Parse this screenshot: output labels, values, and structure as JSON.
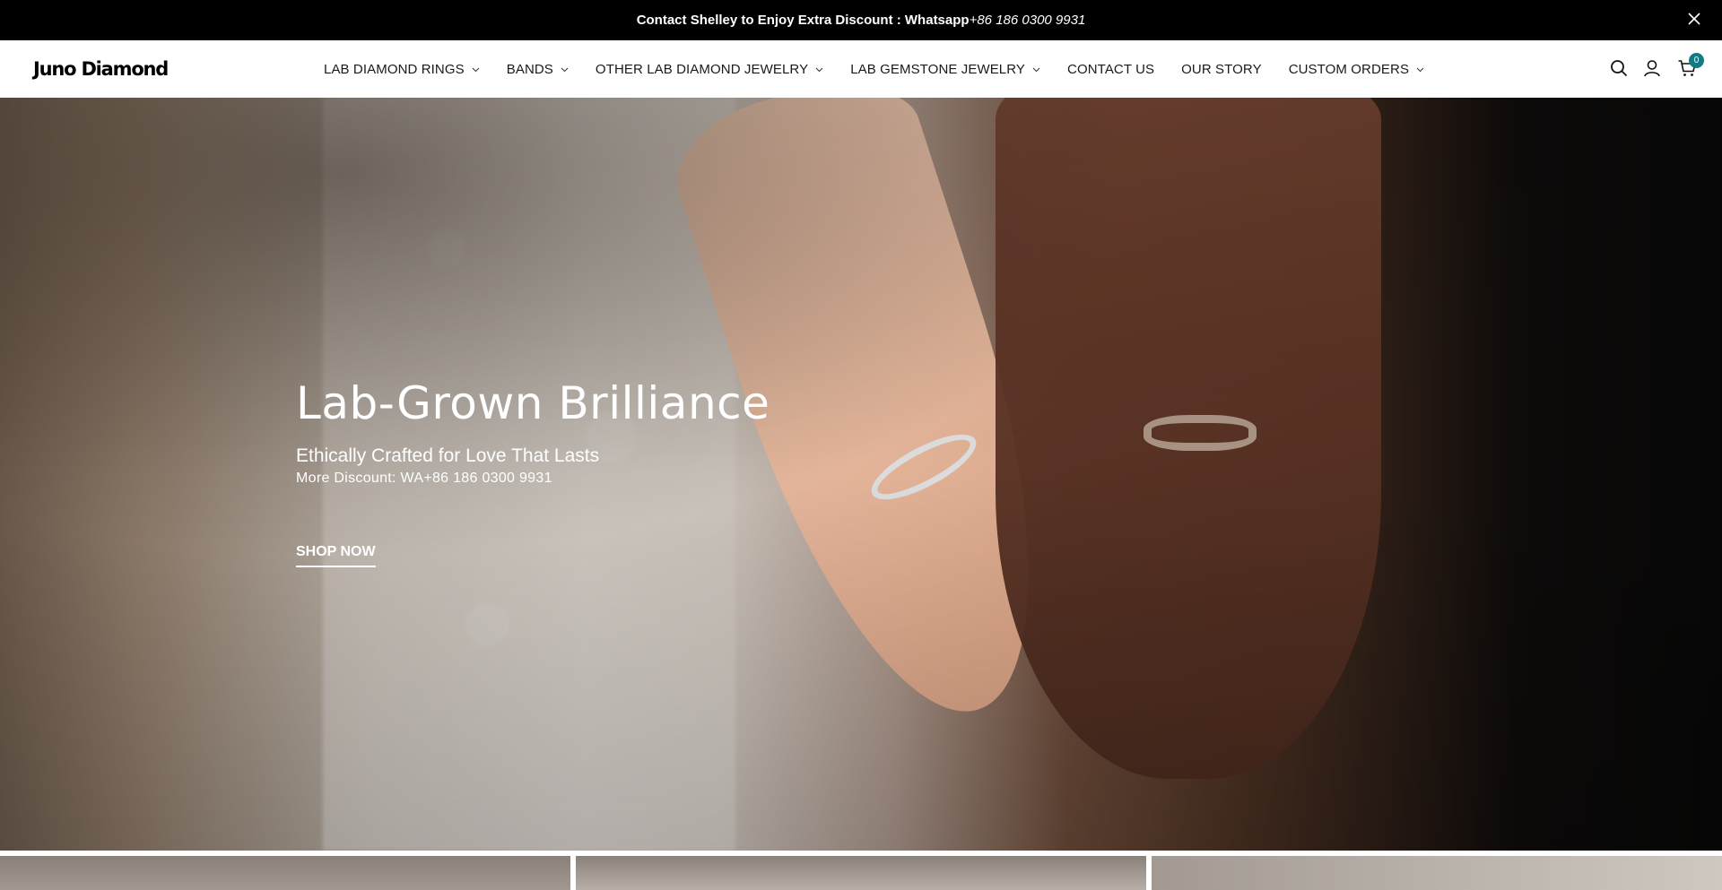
{
  "announcement": {
    "text": "Contact Shelley to Enjoy Extra Discount : Whatsapp",
    "phone": "+86 186 0300 9931"
  },
  "header": {
    "logo": "Juno Diamond",
    "nav": [
      {
        "label": "LAB DIAMOND RINGS",
        "has_dropdown": true
      },
      {
        "label": "BANDS",
        "has_dropdown": true
      },
      {
        "label": "OTHER LAB DIAMOND JEWELRY",
        "has_dropdown": true
      },
      {
        "label": "LAB GEMSTONE JEWELRY",
        "has_dropdown": true
      },
      {
        "label": "CONTACT US",
        "has_dropdown": false
      },
      {
        "label": "OUR STORY",
        "has_dropdown": false
      },
      {
        "label": "CUSTOM ORDERS",
        "has_dropdown": true
      }
    ],
    "icons": [
      "search-icon",
      "account-icon",
      "cart-icon"
    ],
    "cart_count": "0"
  },
  "hero": {
    "title": "Lab-Grown Brilliance",
    "subtitle": "Ethically Crafted for Love That Lasts",
    "discount": "More Discount: WA+86  186 0300 9931",
    "cta": "SHOP NOW"
  },
  "colors": {
    "announcement_bg": "#000000",
    "cart_badge": "#137c83",
    "text": "#1a1a1a"
  }
}
